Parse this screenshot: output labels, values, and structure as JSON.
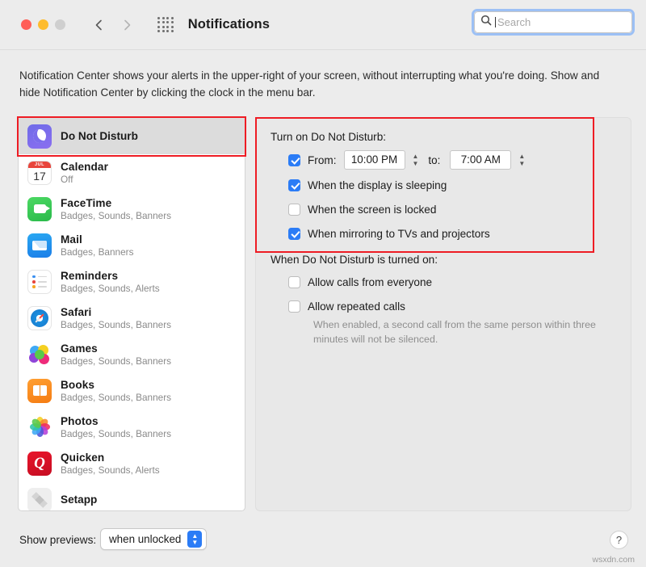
{
  "window": {
    "title": "Notifications",
    "traffic_lights": [
      "close-red",
      "minimize-yellow",
      "zoom-gray-disabled"
    ],
    "back_icon": "chevron-left-icon",
    "forward_icon": "chevron-right-icon",
    "grid_icon": "show-all-grid-icon"
  },
  "search": {
    "placeholder": "Search",
    "value": "",
    "icon": "search-icon",
    "focused": true
  },
  "description": "Notification Center shows your alerts in the upper-right of your screen, without interrupting what you're doing. Show and hide Notification Center by clicking the clock in the menu bar.",
  "sidebar": {
    "items": [
      {
        "name": "Do Not Disturb",
        "sub": "",
        "icon": "do-not-disturb-icon",
        "selected": true
      },
      {
        "name": "Calendar",
        "sub": "Off",
        "icon": "calendar-icon",
        "selected": false,
        "cal_month": "JUL",
        "cal_day": "17"
      },
      {
        "name": "FaceTime",
        "sub": "Badges, Sounds, Banners",
        "icon": "facetime-icon",
        "selected": false
      },
      {
        "name": "Mail",
        "sub": "Badges, Banners",
        "icon": "mail-icon",
        "selected": false
      },
      {
        "name": "Reminders",
        "sub": "Badges, Sounds, Alerts",
        "icon": "reminders-icon",
        "selected": false
      },
      {
        "name": "Safari",
        "sub": "Badges, Sounds, Banners",
        "icon": "safari-icon",
        "selected": false
      },
      {
        "name": "Games",
        "sub": "Badges, Sounds, Banners",
        "icon": "games-icon",
        "selected": false
      },
      {
        "name": "Books",
        "sub": "Badges, Sounds, Banners",
        "icon": "books-icon",
        "selected": false
      },
      {
        "name": "Photos",
        "sub": "Badges, Sounds, Banners",
        "icon": "photos-icon",
        "selected": false
      },
      {
        "name": "Quicken",
        "sub": "Badges, Sounds, Alerts",
        "icon": "quicken-icon",
        "selected": false
      },
      {
        "name": "Setapp",
        "sub": "",
        "icon": "setapp-icon",
        "selected": false
      }
    ]
  },
  "panel": {
    "turn_on_title": "Turn on Do Not Disturb:",
    "schedule": {
      "checked": true,
      "from_label": "From:",
      "from_value": "10:00 PM",
      "to_label": "to:",
      "to_value": "7:00 AM",
      "stepper_icon": "stepper-up-down-icon"
    },
    "options": [
      {
        "label": "When the display is sleeping",
        "checked": true
      },
      {
        "label": "When the screen is locked",
        "checked": false
      },
      {
        "label": "When mirroring to TVs and projectors",
        "checked": true
      }
    ],
    "turned_on_title": "When Do Not Disturb is turned on:",
    "call_options": [
      {
        "label": "Allow calls from everyone",
        "checked": false
      },
      {
        "label": "Allow repeated calls",
        "checked": false
      }
    ],
    "hint": "When enabled, a second call from the same person within three minutes will not be silenced."
  },
  "footer": {
    "previews_label": "Show previews:",
    "previews_value": "when unlocked",
    "popup_icon": "chevron-up-down-icon",
    "help_label": "?",
    "watermark": "wsxdn.com"
  },
  "colors": {
    "accent_blue": "#2b7cf6",
    "annotation_red": "#ee1c24",
    "selected_row": "#dcdcdc"
  }
}
